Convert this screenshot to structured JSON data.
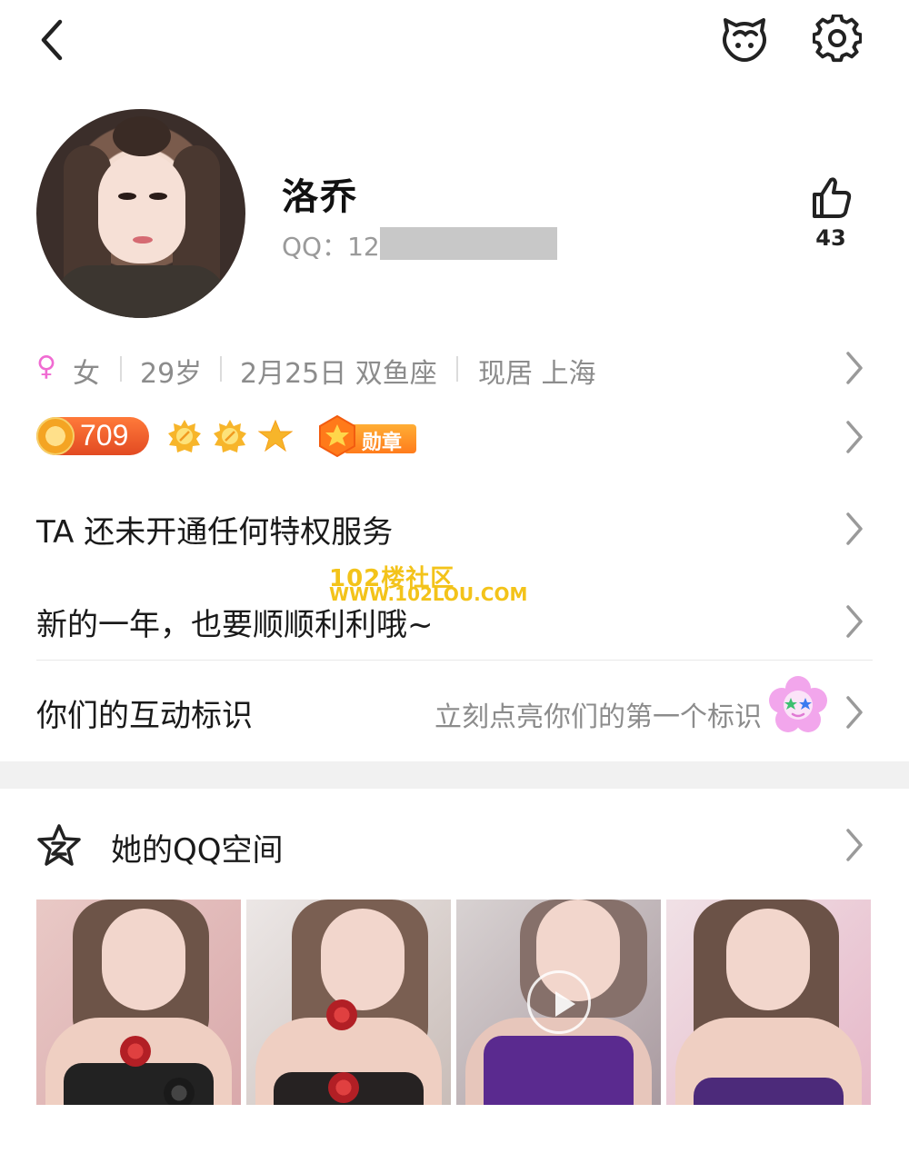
{
  "profile": {
    "name": "洛乔",
    "qq_label": "QQ：12",
    "likes": "43"
  },
  "info": {
    "gender_symbol": "♀",
    "gender": "女",
    "age": "29岁",
    "birthday": "2月25日 双鱼座",
    "location": "现居 上海"
  },
  "badges": {
    "level": "709",
    "medal_label": "勋章"
  },
  "rows": {
    "privilege": "TA 还未开通任何特权服务",
    "signature": "新的一年，也要顺顺利利哦~",
    "interaction": "你们的互动标识",
    "interaction_hint": "立刻点亮你们的第一个标识"
  },
  "watermark": {
    "line1": "102楼社区",
    "line2": "WWW.102LOU.COM"
  },
  "qzone": {
    "title": "她的QQ空间",
    "photos": [
      "photo-1",
      "photo-2",
      "video-3",
      "photo-4"
    ]
  },
  "icons": [
    "back-icon",
    "pet-icon",
    "gear-icon",
    "thumbs-up-icon",
    "chevron-right-icon",
    "sun-icon",
    "star-icon",
    "medal-icon",
    "flower-icon",
    "qzone-star-icon",
    "play-icon"
  ],
  "colors": {
    "gender": "#f06bd2",
    "level_pill": "#e24a22",
    "accent_orange": "#ff7c1c",
    "text_gray": "#8c8c8c",
    "watermark": "#f3c31a"
  }
}
